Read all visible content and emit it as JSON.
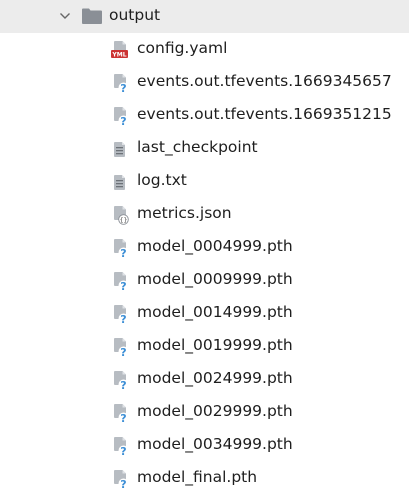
{
  "tree": {
    "folder": {
      "name": "output",
      "expanded": true,
      "icon": "folder-icon",
      "chevron_icon": "chevron-down-icon"
    },
    "files": [
      {
        "name": "config.yaml",
        "icon": "yaml-file-icon"
      },
      {
        "name": "events.out.tfevents.1669345657",
        "icon": "unknown-file-icon"
      },
      {
        "name": "events.out.tfevents.1669351215",
        "icon": "unknown-file-icon"
      },
      {
        "name": "last_checkpoint",
        "icon": "text-file-icon"
      },
      {
        "name": "log.txt",
        "icon": "text-file-icon"
      },
      {
        "name": "metrics.json",
        "icon": "json-file-icon"
      },
      {
        "name": "model_0004999.pth",
        "icon": "unknown-file-icon"
      },
      {
        "name": "model_0009999.pth",
        "icon": "unknown-file-icon"
      },
      {
        "name": "model_0014999.pth",
        "icon": "unknown-file-icon"
      },
      {
        "name": "model_0019999.pth",
        "icon": "unknown-file-icon"
      },
      {
        "name": "model_0024999.pth",
        "icon": "unknown-file-icon"
      },
      {
        "name": "model_0029999.pth",
        "icon": "unknown-file-icon"
      },
      {
        "name": "model_0034999.pth",
        "icon": "unknown-file-icon"
      },
      {
        "name": "model_final.pth",
        "icon": "unknown-file-icon"
      }
    ],
    "colors": {
      "selected_row_bg": "#ececec",
      "folder": "#8a8f96",
      "unknown_badge": "#3d8fd6",
      "yaml_badge": "#cc3333"
    }
  }
}
